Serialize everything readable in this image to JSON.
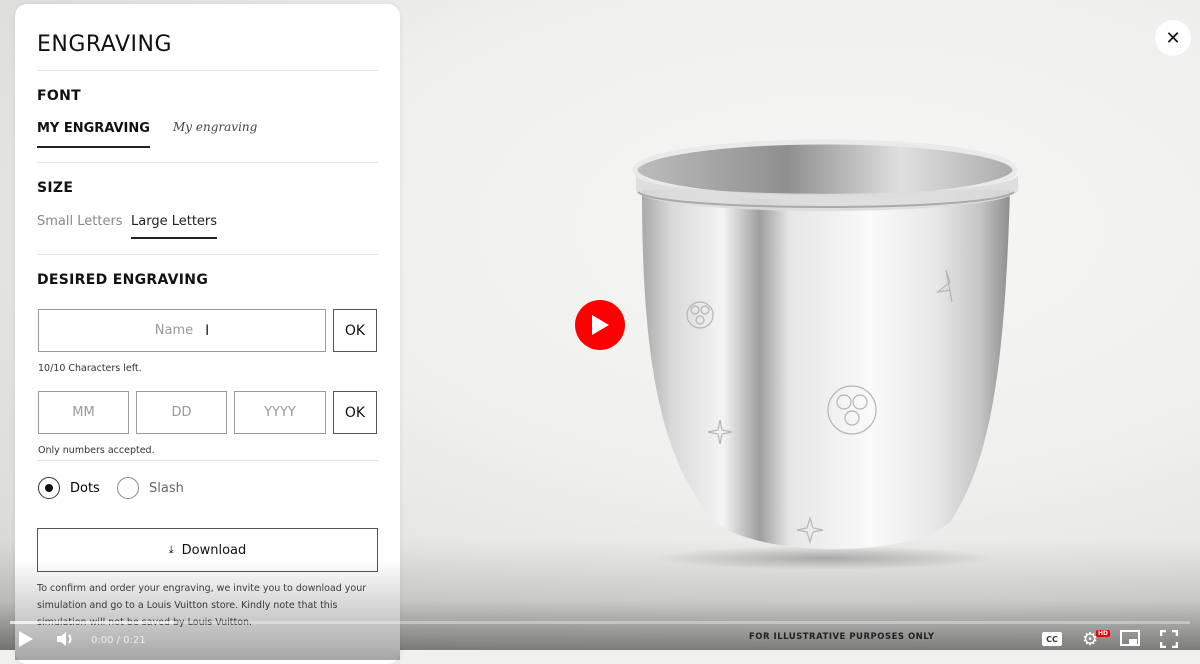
{
  "panel": {
    "title": "ENGRAVING",
    "font": {
      "heading": "FONT",
      "tabs": [
        {
          "label": "MY ENGRAVING",
          "active": true
        },
        {
          "label": "My engraving",
          "active": false
        }
      ]
    },
    "size": {
      "heading": "SIZE",
      "tabs": [
        {
          "label": "Small Letters",
          "active": false
        },
        {
          "label": "Large Letters",
          "active": true
        }
      ]
    },
    "desired": {
      "heading": "DESIRED ENGRAVING",
      "name_placeholder": "Name",
      "name_value": "",
      "ok_label": "OK",
      "chars_left": "10/10 Characters left.",
      "date": {
        "mm_placeholder": "MM",
        "dd_placeholder": "DD",
        "yyyy_placeholder": "YYYY",
        "ok_label": "OK",
        "hint": "Only numbers accepted."
      },
      "separator": {
        "options": [
          {
            "label": "Dots",
            "selected": true
          },
          {
            "label": "Slash",
            "selected": false
          }
        ]
      }
    },
    "download_label": "Download",
    "download_icon": "download-arrow-icon",
    "note": "To confirm and order your engraving, we invite you to download your simulation and go to a Louis Vuitton store. Kindly note that this simulation will not be saved by Louis Vuitton."
  },
  "viewer": {
    "close_icon": "close-icon",
    "play_icon": "play-icon",
    "product_image": "silver-engraved-cup",
    "disclaimer": "FOR ILLUSTRATIVE PURPOSES ONLY"
  },
  "player": {
    "time": "0:00 / 0:21",
    "progress": 0,
    "buffered_fraction": 0.14,
    "quality_badge": "HD",
    "icons": [
      "play-icon",
      "volume-icon",
      "captions-icon",
      "settings-icon",
      "miniplayer-icon",
      "fullscreen-icon"
    ],
    "captions_label": "CC",
    "accent_color": "#ff0000"
  }
}
